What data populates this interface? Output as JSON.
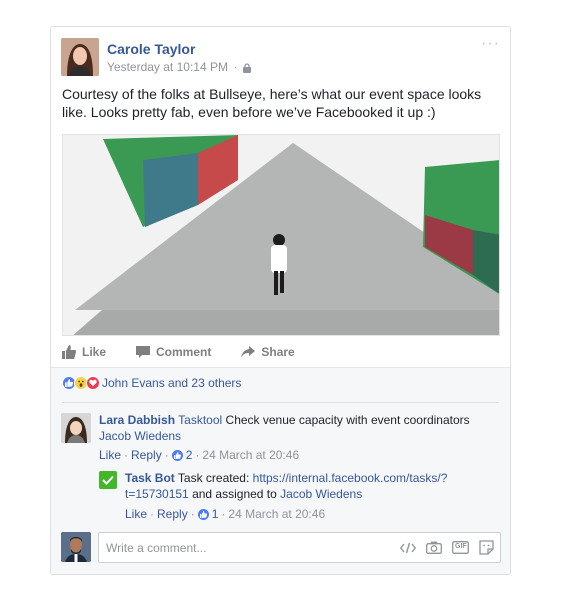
{
  "post": {
    "author": "Carole Taylor",
    "timestamp": "Yesterday at 10:14 PM",
    "separator": "·",
    "more": "···",
    "text": "Courtesy of the folks at Bullseye, here’s what our event space looks like. Looks pretty fab, even before we’ve Facebooked it up :)",
    "image_alt": "Event space photo"
  },
  "actions": {
    "like": "Like",
    "comment": "Comment",
    "share": "Share"
  },
  "reactions": {
    "icons": [
      "like-reaction",
      "wow-reaction",
      "love-reaction"
    ],
    "text": "John Evans and 23 others"
  },
  "comments": [
    {
      "author": "Lara Dabbish",
      "mention": "Tasktool",
      "text": "Check venue capacity with event coordinators",
      "tag": "Jacob Wiedens",
      "like_label": "Like",
      "reply_label": "Reply",
      "like_count": "2",
      "time": "24 March at 20:46",
      "sep": "·"
    },
    {
      "author": "Task Bot",
      "text_prefix": "Task created:",
      "url": "https://internal.facebook.com/tasks/?t=15730151",
      "text_mid": "and assigned to",
      "assignee": "Jacob Wiedens",
      "like_label": "Like",
      "reply_label": "Reply",
      "like_count": "1",
      "time": "24 March at 20:46",
      "sep": "·"
    }
  ],
  "composer": {
    "placeholder": "Write a comment...",
    "icons": [
      "code-icon",
      "camera-icon",
      "gif-icon",
      "sticker-icon"
    ],
    "gif_label": "GIF"
  },
  "colors": {
    "link": "#365899",
    "like_blue": "#4b7cf3",
    "bot_green": "#42b72a",
    "muted": "#90949c"
  }
}
